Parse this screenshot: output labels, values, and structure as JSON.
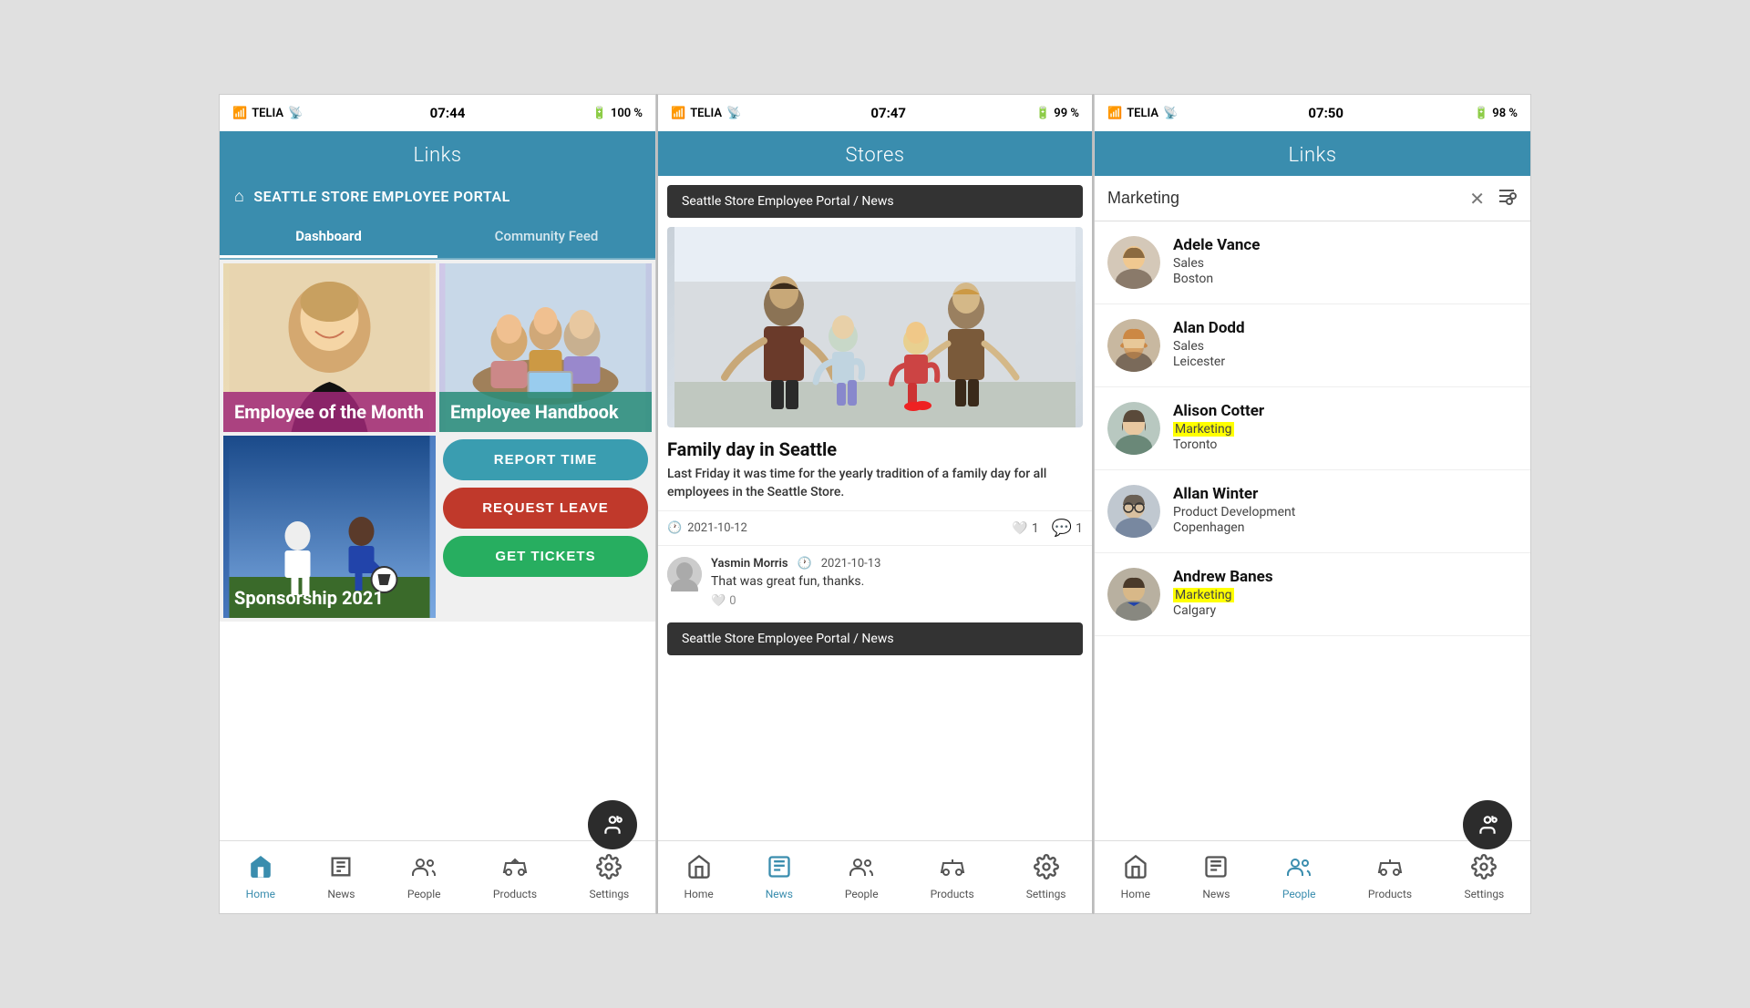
{
  "screen1": {
    "statusBar": {
      "signal": "TELIA",
      "time": "07:44",
      "battery": "100 %"
    },
    "header": {
      "title": "Links"
    },
    "portalLabel": "SEATTLE STORE EMPLOYEE PORTAL",
    "tabs": [
      {
        "label": "Dashboard",
        "active": true
      },
      {
        "label": "Community Feed",
        "active": false
      }
    ],
    "gridItems": [
      {
        "id": "eom",
        "label": "Employee of the Month"
      },
      {
        "id": "handbook",
        "label": "Employee Handbook"
      },
      {
        "id": "sponsorship",
        "label": "Sponsorship 2021"
      }
    ],
    "buttons": [
      {
        "id": "report-time",
        "label": "REPORT TIME",
        "color": "teal"
      },
      {
        "id": "request-leave",
        "label": "REQUEST LEAVE",
        "color": "red"
      },
      {
        "id": "get-tickets",
        "label": "GET TICKETS",
        "color": "green"
      }
    ],
    "nav": [
      {
        "id": "home",
        "label": "Home",
        "icon": "⌂",
        "active": true
      },
      {
        "id": "news",
        "label": "News",
        "icon": "📰",
        "active": false
      },
      {
        "id": "people",
        "label": "People",
        "icon": "👥",
        "active": false
      },
      {
        "id": "products",
        "label": "Products",
        "icon": "🚲",
        "active": false
      },
      {
        "id": "settings",
        "label": "Settings",
        "icon": "⚙",
        "active": false
      }
    ]
  },
  "screen2": {
    "statusBar": {
      "signal": "TELIA",
      "time": "07:47",
      "battery": "99 %"
    },
    "header": {
      "title": "Stores"
    },
    "breadcrumb": "Seattle Store Employee Portal / News",
    "article": {
      "title": "Family day in Seattle",
      "excerpt": "Last Friday it was time for the yearly tradition of a family day for all employees in the Seattle Store.",
      "date": "2021-10-12",
      "likes": 1,
      "comments": 1
    },
    "comment": {
      "author": "Yasmin Morris",
      "date": "2021-10-13",
      "text": "That was great fun, thanks.",
      "likes": 0
    },
    "breadcrumb2": "Seattle Store Employee Portal / News",
    "nav": [
      {
        "id": "home",
        "label": "Home",
        "icon": "⌂",
        "active": false
      },
      {
        "id": "news",
        "label": "News",
        "icon": "📰",
        "active": true
      },
      {
        "id": "people",
        "label": "People",
        "icon": "👥",
        "active": false
      },
      {
        "id": "products",
        "label": "Products",
        "icon": "🚲",
        "active": false
      },
      {
        "id": "settings",
        "label": "Settings",
        "icon": "⚙",
        "active": false
      }
    ]
  },
  "screen3": {
    "statusBar": {
      "signal": "TELIA",
      "time": "07:50",
      "battery": "98 %"
    },
    "header": {
      "title": "Links"
    },
    "searchQuery": "Marketing",
    "people": [
      {
        "id": "adele-vance",
        "name": "Adele Vance",
        "dept": "Sales",
        "city": "Boston",
        "highlight": false,
        "highlightField": ""
      },
      {
        "id": "alan-dodd",
        "name": "Alan Dodd",
        "dept": "Sales",
        "city": "Leicester",
        "highlight": false,
        "highlightField": ""
      },
      {
        "id": "alison-cotter",
        "name": "Alison Cotter",
        "dept": "Marketing",
        "city": "Toronto",
        "highlight": true,
        "highlightField": "dept"
      },
      {
        "id": "allan-winter",
        "name": "Allan Winter",
        "dept": "Product Development",
        "city": "Copenhagen",
        "highlight": false,
        "highlightField": ""
      },
      {
        "id": "andrew-banes",
        "name": "Andrew Banes",
        "dept": "Marketing",
        "city": "Calgary",
        "highlight": true,
        "highlightField": "dept"
      }
    ],
    "nav": [
      {
        "id": "home",
        "label": "Home",
        "icon": "⌂",
        "active": false
      },
      {
        "id": "news",
        "label": "News",
        "icon": "📰",
        "active": false
      },
      {
        "id": "people",
        "label": "People",
        "icon": "👥",
        "active": true
      },
      {
        "id": "products",
        "label": "Products",
        "icon": "🚲",
        "active": false
      },
      {
        "id": "settings",
        "label": "Settings",
        "icon": "⚙",
        "active": false
      }
    ]
  }
}
